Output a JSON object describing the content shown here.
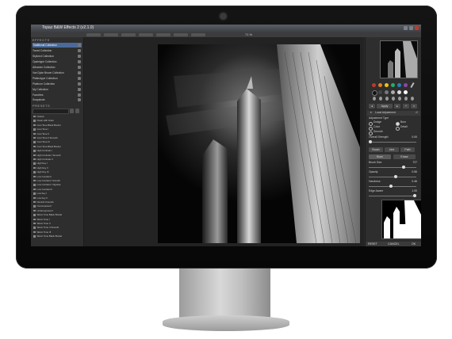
{
  "app": {
    "title": "Topaz B&W Effects 2 (v2.1.0)",
    "zoom": "71 %"
  },
  "left_panel": {
    "effects_header": "EFFECTS",
    "collections": [
      {
        "label": "Traditional Collection",
        "selected": true
      },
      {
        "label": "Toned Collection"
      },
      {
        "label": "Stylized Collection"
      },
      {
        "label": "Opalotype Collection"
      },
      {
        "label": "Albumen Collection"
      },
      {
        "label": "Van Dyke Brown Collection"
      },
      {
        "label": "Platinotype Collection"
      },
      {
        "label": "Platinum Collection"
      },
      {
        "label": "My Collection"
      },
      {
        "label": "Favorites"
      },
      {
        "label": "Snapshots"
      }
    ],
    "presets_header": "PRESETS",
    "presets": [
      "Classic",
      "Clean with Grain",
      "Cool Tone Black Border",
      "Cool Tone I",
      "Cool Tone II",
      "Cool Tone II Smooth",
      "Cool Tone III",
      "Cool Tone Black Border",
      "High Contrast I",
      "High Contrast I Smooth",
      "High Contrast II",
      "High Key I",
      "High Key II",
      "High Key III",
      "Low Contrast I",
      "Low Contrast I Smooth",
      "Low Contrast I Vignette",
      "Low Contrast II",
      "Low Key I",
      "Low Key II",
      "Neutral Grounds",
      "Overexposed I",
      "Underexposed I",
      "Warm Tone Black Border",
      "Warm Tone I",
      "Warm Tone II",
      "Warm Tone II Smooth",
      "Warm Tone III",
      "Warm Tone Black Border"
    ]
  },
  "right_panel": {
    "colors": [
      "#c0392b",
      "#e67e22",
      "#f1c40f",
      "#27ae60",
      "#2980b9",
      "#8e44ad"
    ],
    "apply_label": "Apply",
    "local_adjustment_label": "Local Adjustment",
    "adjustment_type_label": "Adjustment Type",
    "options": {
      "dodge": "Dodge",
      "burn": "Burn",
      "color": "Color",
      "detail": "Detail",
      "smooth": "Smooth"
    },
    "overall_strength": {
      "label": "Overall Strength",
      "value": "0.00"
    },
    "brush_tabs": [
      "Brush",
      "Line",
      "Path"
    ],
    "burn_label": "Burn",
    "erase_label": "Erase",
    "brush_size": {
      "label": "Brush Size",
      "value": "727"
    },
    "opacity": {
      "label": "Opacity",
      "value": "0.56"
    },
    "hardness": {
      "label": "Hardness",
      "value": "0.46"
    },
    "edge_aware": {
      "label": "Edge Aware",
      "value": "1.00"
    }
  },
  "bottom": {
    "reset": "RESET",
    "cancel": "CANCEL",
    "ok": "OK"
  }
}
